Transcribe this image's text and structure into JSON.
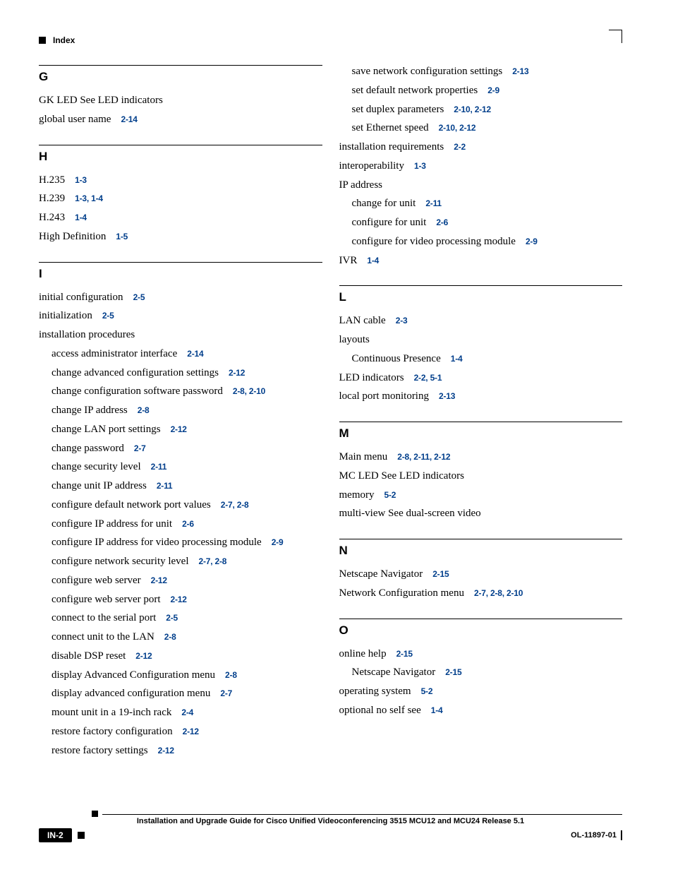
{
  "page_header": {
    "label": "Index"
  },
  "footer": {
    "title": "Installation and Upgrade Guide for Cisco Unified Videoconferencing 3515 MCU12 and MCU24 Release 5.1",
    "page_number": "IN-2",
    "doc_id": "OL-11897-01"
  },
  "sections": [
    {
      "letter": "G",
      "entries": [
        {
          "t": "GK LED See LED indicators",
          "p": ""
        },
        {
          "t": "global user name",
          "p": "2-14"
        }
      ]
    },
    {
      "letter": "H",
      "entries": [
        {
          "t": "H.235",
          "p": "1-3"
        },
        {
          "t": "H.239",
          "p": "1-3, 1-4"
        },
        {
          "t": "H.243",
          "p": "1-4"
        },
        {
          "t": "High Definition",
          "p": "1-5"
        }
      ]
    },
    {
      "letter": "I",
      "entries": [
        {
          "t": "initial configuration",
          "p": "2-5"
        },
        {
          "t": "initialization",
          "p": "2-5"
        },
        {
          "t": "installation procedures",
          "p": ""
        },
        {
          "t": "access administrator interface",
          "p": "2-14",
          "indent": 1
        },
        {
          "t": "change advanced configuration settings",
          "p": "2-12",
          "indent": 1
        },
        {
          "t": "change configuration software password",
          "p": "2-8, 2-10",
          "indent": 1
        },
        {
          "t": "change IP address",
          "p": "2-8",
          "indent": 1
        },
        {
          "t": "change LAN port settings",
          "p": "2-12",
          "indent": 1
        },
        {
          "t": "change password",
          "p": "2-7",
          "indent": 1
        },
        {
          "t": "change security level",
          "p": "2-11",
          "indent": 1
        },
        {
          "t": "change unit IP address",
          "p": "2-11",
          "indent": 1
        },
        {
          "t": "configure default network port values",
          "p": "2-7, 2-8",
          "indent": 1
        },
        {
          "t": "configure IP address for unit",
          "p": "2-6",
          "indent": 1
        },
        {
          "t": "configure IP address for video processing module",
          "p": "2-9",
          "indent": 1
        },
        {
          "t": "configure network security level",
          "p": "2-7, 2-8",
          "indent": 1
        },
        {
          "t": "configure web server",
          "p": "2-12",
          "indent": 1
        },
        {
          "t": "configure web server port",
          "p": "2-12",
          "indent": 1
        },
        {
          "t": "connect to the serial port",
          "p": "2-5",
          "indent": 1
        },
        {
          "t": "connect unit to the LAN",
          "p": "2-8",
          "indent": 1
        },
        {
          "t": "disable DSP reset",
          "p": "2-12",
          "indent": 1
        },
        {
          "t": "display Advanced Configuration menu",
          "p": "2-8",
          "indent": 1
        },
        {
          "t": "display advanced configuration menu",
          "p": "2-7",
          "indent": 1
        },
        {
          "t": "mount unit in a 19-inch rack",
          "p": "2-4",
          "indent": 1
        },
        {
          "t": "restore factory configuration",
          "p": "2-12",
          "indent": 1
        },
        {
          "t": "restore factory settings",
          "p": "2-12",
          "indent": 1
        }
      ]
    },
    {
      "letter": "_CONT_I",
      "entries": [
        {
          "t": "save network configuration settings",
          "p": "2-13",
          "indent": 1
        },
        {
          "t": "set default network properties",
          "p": "2-9",
          "indent": 1
        },
        {
          "t": "set duplex parameters",
          "p": "2-10, 2-12",
          "indent": 1
        },
        {
          "t": "set Ethernet speed",
          "p": "2-10, 2-12",
          "indent": 1
        },
        {
          "t": "installation requirements",
          "p": "2-2"
        },
        {
          "t": "interoperability",
          "p": "1-3"
        },
        {
          "t": "IP address",
          "p": ""
        },
        {
          "t": "change for unit",
          "p": "2-11",
          "indent": 1
        },
        {
          "t": "configure for unit",
          "p": "2-6",
          "indent": 1
        },
        {
          "t": "configure for video processing module",
          "p": "2-9",
          "indent": 1
        },
        {
          "t": "IVR",
          "p": "1-4"
        }
      ]
    },
    {
      "letter": "L",
      "entries": [
        {
          "t": "LAN cable",
          "p": "2-3"
        },
        {
          "t": "layouts",
          "p": ""
        },
        {
          "t": "Continuous Presence",
          "p": "1-4",
          "indent": 1
        },
        {
          "t": "LED indicators",
          "p": "2-2, 5-1"
        },
        {
          "t": "local port monitoring",
          "p": "2-13"
        }
      ]
    },
    {
      "letter": "M",
      "entries": [
        {
          "t": "Main menu",
          "p": "2-8, 2-11, 2-12"
        },
        {
          "t": "MC LED See LED indicators",
          "p": ""
        },
        {
          "t": "memory",
          "p": "5-2"
        },
        {
          "t": "multi-view See dual-screen video",
          "p": ""
        }
      ]
    },
    {
      "letter": "N",
      "entries": [
        {
          "t": "Netscape Navigator",
          "p": "2-15"
        },
        {
          "t": "Network Configuration menu",
          "p": "2-7, 2-8, 2-10"
        }
      ]
    },
    {
      "letter": "O",
      "entries": [
        {
          "t": "online help",
          "p": "2-15"
        },
        {
          "t": "Netscape Navigator",
          "p": "2-15",
          "indent": 1
        },
        {
          "t": "operating system",
          "p": "5-2"
        },
        {
          "t": "optional no self see",
          "p": "1-4"
        }
      ]
    }
  ],
  "column_split": 3
}
